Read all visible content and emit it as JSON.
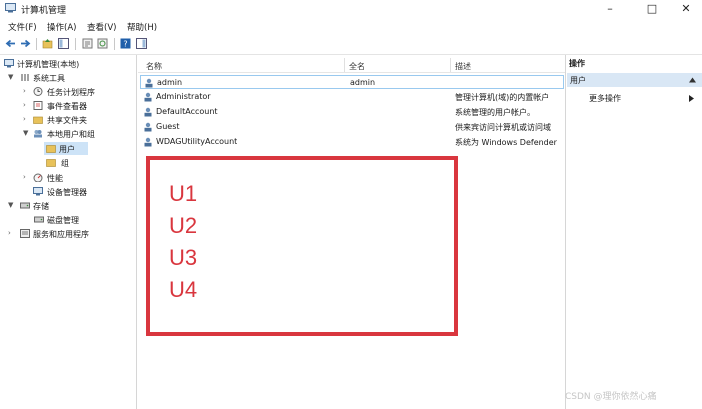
{
  "window": {
    "title": "计算机管理",
    "controls": {
      "minimize": "–",
      "maximize": "□",
      "close": "✕"
    }
  },
  "menu": [
    "文件(F)",
    "操作(A)",
    "查看(V)",
    "帮助(H)"
  ],
  "tree": {
    "root": "计算机管理(本地)",
    "system_tools": "系统工具",
    "task_scheduler": "任务计划程序",
    "event_viewer": "事件查看器",
    "shared_folders": "共享文件夹",
    "local_users_groups": "本地用户和组",
    "users": "用户",
    "groups": "组",
    "performance": "性能",
    "device_manager": "设备管理器",
    "storage": "存储",
    "disk_management": "磁盘管理",
    "services_apps": "服务和应用程序"
  },
  "list": {
    "columns": {
      "name": "名称",
      "fullname": "全名",
      "description": "描述"
    },
    "rows": [
      {
        "name": "admin",
        "fullname": "admin",
        "description": ""
      },
      {
        "name": "Administrator",
        "fullname": "",
        "description": "管理计算机(域)的内置帐户"
      },
      {
        "name": "DefaultAccount",
        "fullname": "",
        "description": "系统管理的用户帐户。"
      },
      {
        "name": "Guest",
        "fullname": "",
        "description": "供来宾访问计算机或访问域"
      },
      {
        "name": "WDAGUtilityAccount",
        "fullname": "",
        "description": "系统为 Windows Defender"
      }
    ]
  },
  "annotation": {
    "labels": [
      "U1",
      "U2",
      "U3",
      "U4"
    ],
    "color": "#d9363e"
  },
  "actions": {
    "header": "操作",
    "selected": "用户",
    "more": "更多操作"
  },
  "watermark": "CSDN @理你依然心痛"
}
